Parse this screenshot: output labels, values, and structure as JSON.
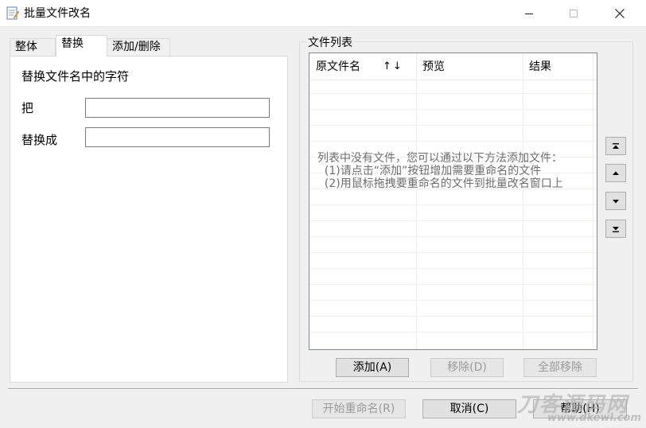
{
  "window": {
    "title": "批量文件改名"
  },
  "tabs": [
    {
      "label": "整体"
    },
    {
      "label": "替换"
    },
    {
      "label": "添加/删除"
    }
  ],
  "replace_panel": {
    "heading": "替换文件名中的字符",
    "from_label": "把",
    "from_value": "",
    "to_label": "替换成",
    "to_value": ""
  },
  "file_list": {
    "group_label": "文件列表",
    "columns": [
      "原文件名",
      "预览",
      "结果"
    ],
    "sort_icon": "↑↓",
    "empty_message": "列表中没有文件，您可以通过以下方法添加文件：\n  (1)请点击“添加”按钮增加需要重命名的文件\n  (2)用鼠标拖拽要重命名的文件到批量改名窗口上",
    "add_button": "添加(A)",
    "remove_button": "移除(D)",
    "remove_all_button": "全部移除"
  },
  "side_buttons": {
    "icons": [
      "move-top-icon",
      "move-up-icon",
      "move-down-icon",
      "move-bottom-icon"
    ]
  },
  "footer": {
    "start_button": "开始重命名(R)",
    "cancel_button": "取消(C)",
    "help_button": "帮助(H)"
  },
  "watermark": {
    "main": "刀客源码网",
    "sub": "www.dkewl.com"
  }
}
